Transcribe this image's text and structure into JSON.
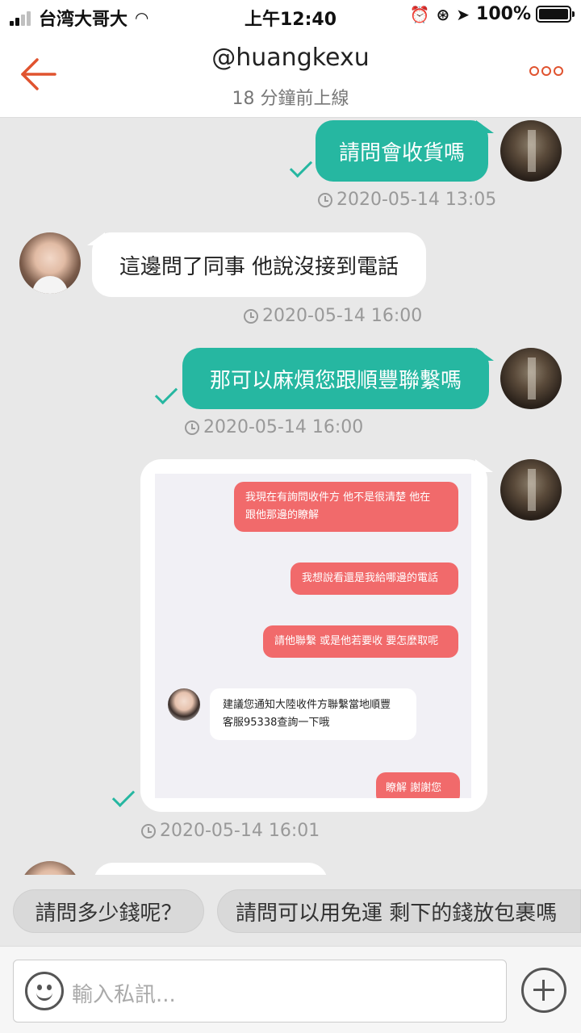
{
  "status_bar": {
    "carrier": "台湾大哥大",
    "time": "上午12:40",
    "battery": "100%"
  },
  "header": {
    "title": "@huangkexu",
    "subtitle": "18 分鐘前上線"
  },
  "messages": [
    {
      "sender": "self",
      "text": "請問會收貨嗎",
      "time": "2020-05-14 13:05"
    },
    {
      "sender": "peer",
      "text": "這邊問了同事 他說沒接到電話",
      "time": "2020-05-14 16:00"
    },
    {
      "sender": "self",
      "text": "那可以麻煩您跟順豐聯繫嗎",
      "time": "2020-05-14 16:00"
    },
    {
      "sender": "self",
      "type": "image",
      "time": "2020-05-14 16:01",
      "screenshot": {
        "line1": "我現在有詢問收件方 他不是很清楚 他在",
        "line2": "跟他那邊的瞭解",
        "msg2": "我想說看還是我給哪邊的電話",
        "msg3": "請他聯繫 或是他若要收 要怎麼取呢",
        "reply_line1": "建議您通知大陸收件方聯繫當地順豐",
        "reply_line2": "客服95338查詢一下哦",
        "msg4": "瞭解 謝謝您"
      }
    }
  ],
  "quick_replies": [
    "請問多少錢呢？",
    "請問可以用免運 剩下的錢放包裹嗎"
  ],
  "input": {
    "placeholder": "輸入私訊..."
  }
}
